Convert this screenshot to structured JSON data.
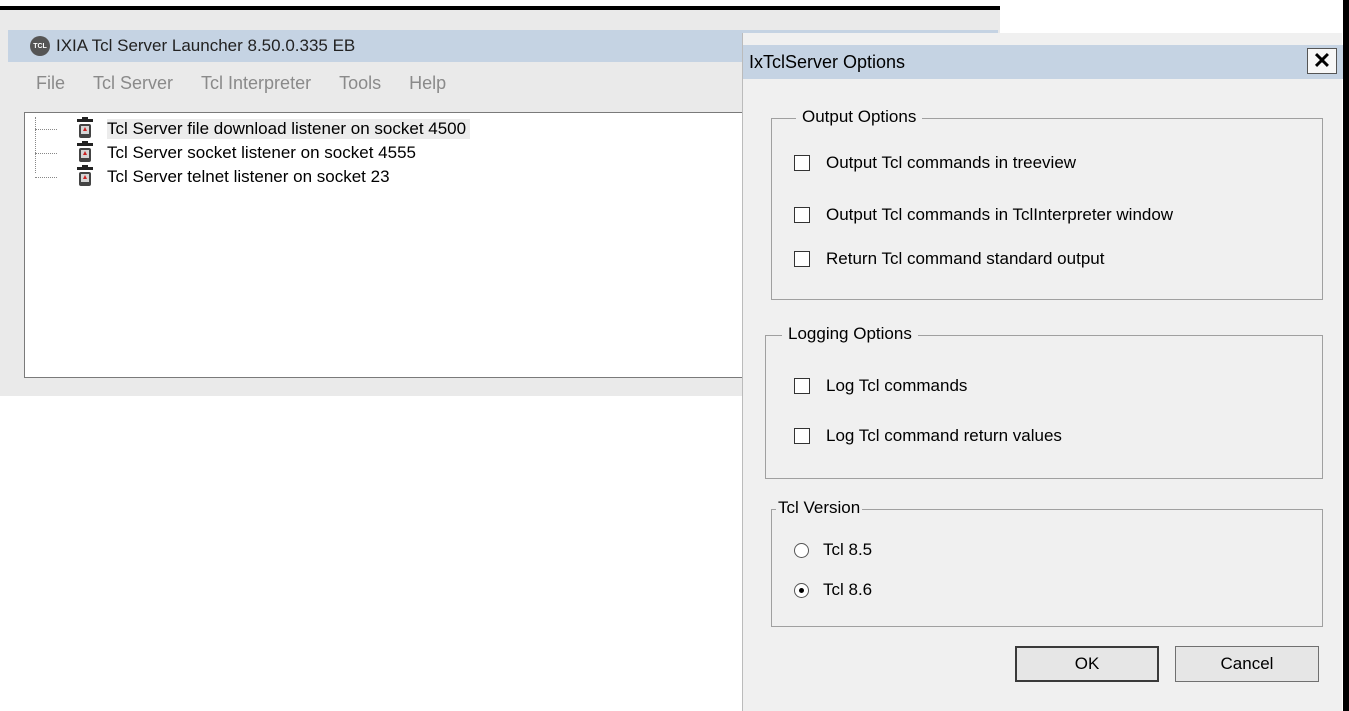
{
  "main_window": {
    "title": "IXIA Tcl Server Launcher 8.50.0.335 EB",
    "icon_text": "TCL",
    "menu": [
      "File",
      "Tcl Server",
      "Tcl Interpreter",
      "Tools",
      "Help"
    ],
    "tree_items": [
      {
        "label": "Tcl Server file download listener on socket 4500",
        "selected": true
      },
      {
        "label": "Tcl Server socket listener on socket 4555",
        "selected": false
      },
      {
        "label": "Tcl Server telnet listener on socket 23",
        "selected": false
      }
    ]
  },
  "dialog": {
    "title": "IxTclServer Options",
    "close_label": "✕",
    "output_options": {
      "legend": "Output Options",
      "items": [
        {
          "label": "Output Tcl commands in treeview",
          "checked": false
        },
        {
          "label": "Output Tcl commands in TclInterpreter window",
          "checked": false
        },
        {
          "label": "Return Tcl command standard output",
          "checked": false
        }
      ]
    },
    "logging_options": {
      "legend": "Logging Options",
      "items": [
        {
          "label": "Log Tcl commands",
          "checked": false
        },
        {
          "label": "Log Tcl command return values",
          "checked": false
        }
      ]
    },
    "tcl_version": {
      "legend": "Tcl Version",
      "items": [
        {
          "label": "Tcl 8.5",
          "checked": false
        },
        {
          "label": "Tcl 8.6",
          "checked": true
        }
      ]
    },
    "ok_label": "OK",
    "cancel_label": "Cancel"
  }
}
